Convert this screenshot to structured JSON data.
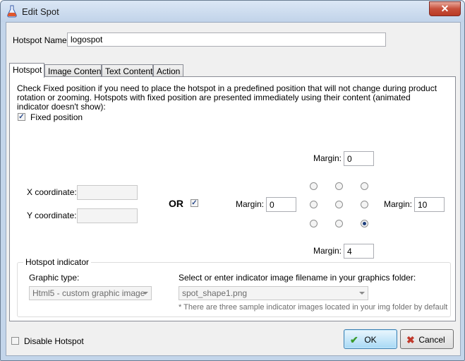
{
  "window": {
    "title": "Edit Spot",
    "close_label": "✕"
  },
  "hotspot_name": {
    "label": "Hotspot Name:",
    "value": "logospot"
  },
  "tabs": [
    {
      "label": "Hotspot",
      "active": true
    },
    {
      "label": "Image Content",
      "active": false
    },
    {
      "label": "Text Content",
      "active": false
    },
    {
      "label": "Action",
      "active": false
    }
  ],
  "hotspot_tab": {
    "description": "Check Fixed position if you need to place the hotspot in a predefined position that will not change during product rotation or zooming. Hotspots with fixed position are presented immediately using their content (animated indicator doesn't show):",
    "fixed_position": {
      "label": "Fixed position",
      "checked": true
    },
    "x_coordinate": {
      "label": "X coordinate:",
      "value": ""
    },
    "y_coordinate": {
      "label": "Y coordinate:",
      "value": ""
    },
    "or_label": "OR",
    "or_checked": true,
    "margin_top": {
      "label": "Margin:",
      "value": "0"
    },
    "margin_left": {
      "label": "Margin:",
      "value": "0"
    },
    "margin_right": {
      "label": "Margin:",
      "value": "10"
    },
    "margin_bottom": {
      "label": "Margin:",
      "value": "4"
    },
    "position_selected": "bottom-right"
  },
  "indicator": {
    "group_title": "Hotspot indicator",
    "graphic_type_label": "Graphic type:",
    "graphic_type_value": "Html5 - custom graphic image",
    "filename_label": "Select or enter indicator image filename in your graphics folder:",
    "filename_value": "spot_shape1.png",
    "note": "* There are three sample indicator images located in your img folder by default"
  },
  "footer": {
    "disable_label": "Disable Hotspot",
    "disable_checked": false,
    "ok_label": "OK",
    "cancel_label": "Cancel"
  },
  "colors": {
    "ok_icon": "#3a9a2a",
    "cancel_icon": "#c0392b",
    "titlebar": "#c3d5ea"
  }
}
